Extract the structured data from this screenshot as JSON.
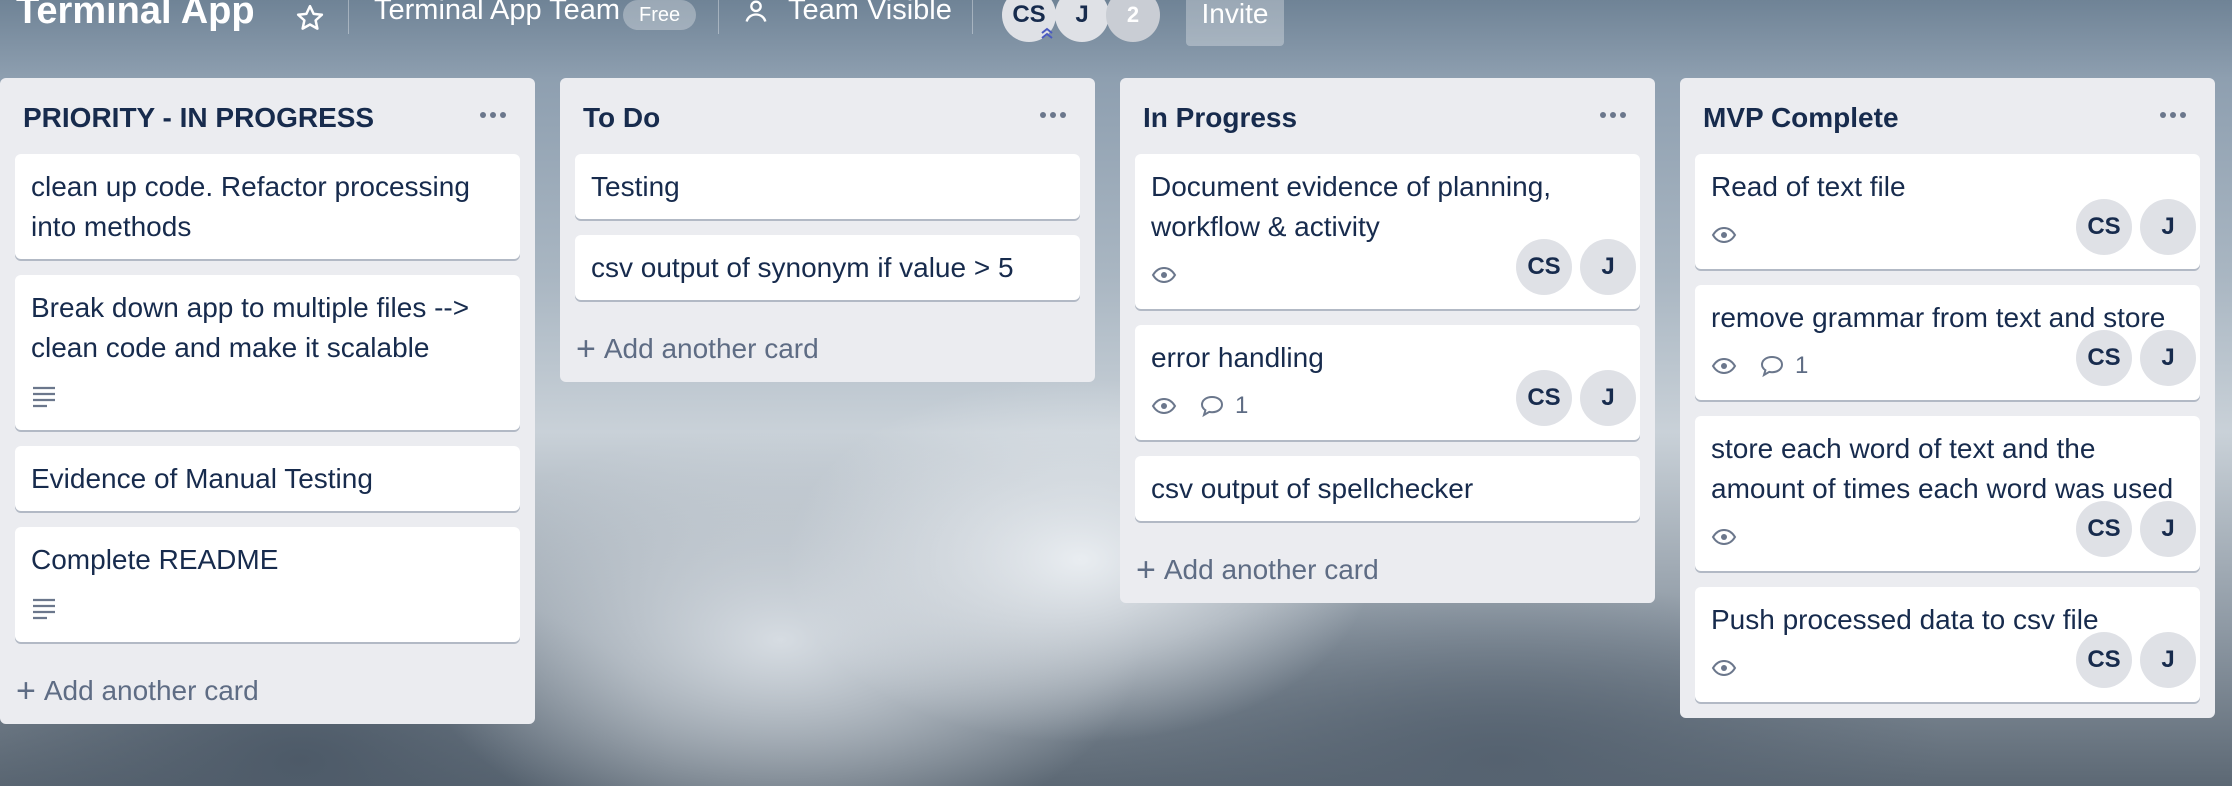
{
  "header": {
    "board_title": "Terminal App",
    "team_name": "Terminal App Team",
    "plan_badge": "Free",
    "visibility": "Team Visible",
    "members": [
      "CS",
      "J"
    ],
    "extra_members": "2",
    "invite": "Invite"
  },
  "lists": [
    {
      "title": "PRIORITY - IN PROGRESS",
      "cards": [
        {
          "title": "clean up code. Refactor processing into methods"
        },
        {
          "title": "Break down app to multiple files --> clean code and make it scalable",
          "description_icon": "description-icon"
        },
        {
          "title": "Evidence of Manual Testing"
        },
        {
          "title": "Complete README",
          "description_icon": "description-icon"
        }
      ],
      "add_card": "Add another card"
    },
    {
      "title": "To Do",
      "cards": [
        {
          "title": "Testing"
        },
        {
          "title": "csv output of synonym if value > 5"
        }
      ],
      "add_card": "Add another card"
    },
    {
      "title": "In Progress",
      "cards": [
        {
          "title": "Document evidence of planning, workflow & activity",
          "members": [
            "CS",
            "J"
          ]
        },
        {
          "title": "error handling",
          "comments": "1",
          "members": [
            "CS",
            "J"
          ]
        },
        {
          "title": "csv output of spellchecker"
        }
      ],
      "add_card": "Add another card"
    },
    {
      "title": "MVP Complete",
      "cards": [
        {
          "title": "Read of text file",
          "members": [
            "CS",
            "J"
          ]
        },
        {
          "title": "remove grammar from text and store",
          "comments": "1",
          "members": [
            "CS",
            "J"
          ]
        },
        {
          "title": "store each word of text and the amount of times each word was used",
          "members": [
            "CS",
            "J"
          ]
        },
        {
          "title": "Push processed data to csv file",
          "members": [
            "CS",
            "J"
          ]
        }
      ]
    }
  ]
}
